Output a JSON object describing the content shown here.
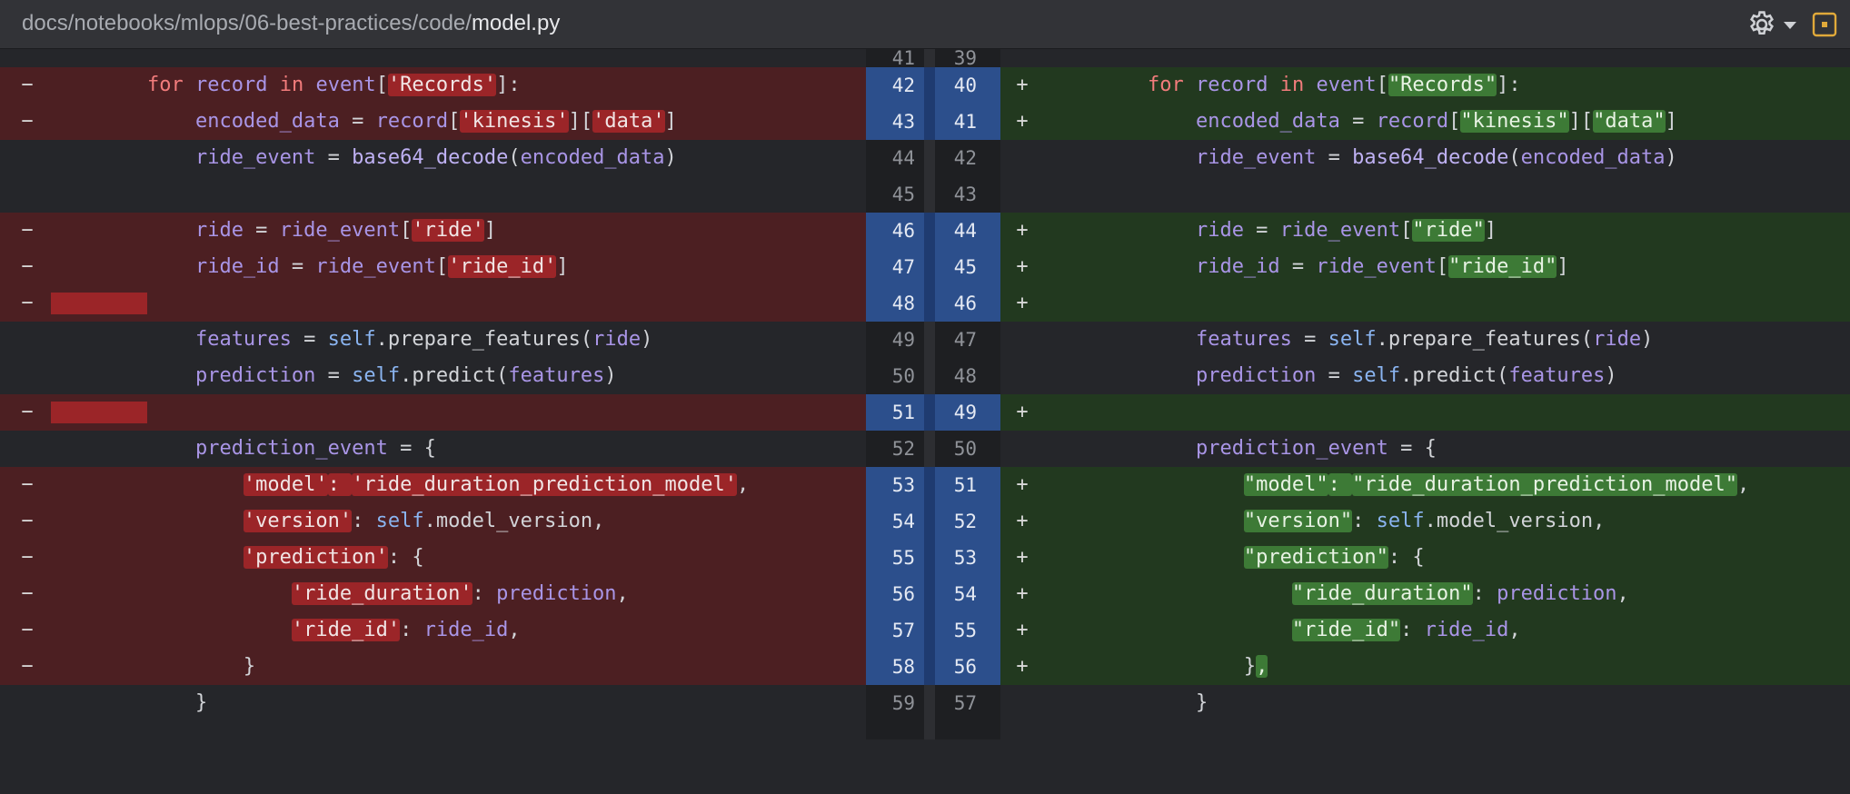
{
  "header": {
    "path_prefix": "docs/notebooks/mlops/06-best-practices/code/",
    "file_name": "model.py"
  },
  "diff": {
    "colors": {
      "deleted_bg": "#4c1f22",
      "added_bg": "#22391f",
      "line_number_changed_bg": "#2c4f8c"
    },
    "rows": [
      {
        "l": "41",
        "r": "39"
      },
      {
        "l": "42",
        "r": "40",
        "dm": "−",
        "am": "+"
      },
      {
        "l": "43",
        "r": "41",
        "dm": "−",
        "am": "+"
      },
      {
        "l": "44",
        "r": "42"
      },
      {
        "l": "45",
        "r": "43"
      },
      {
        "l": "46",
        "r": "44",
        "dm": "−",
        "am": "+"
      },
      {
        "l": "47",
        "r": "45",
        "dm": "−",
        "am": "+"
      },
      {
        "l": "48",
        "r": "46",
        "dm": "−",
        "am": "+"
      },
      {
        "l": "49",
        "r": "47"
      },
      {
        "l": "50",
        "r": "48"
      },
      {
        "l": "51",
        "r": "49",
        "dm": "−",
        "am": "+"
      },
      {
        "l": "52",
        "r": "50"
      },
      {
        "l": "53",
        "r": "51",
        "dm": "−",
        "am": "+"
      },
      {
        "l": "54",
        "r": "52",
        "dm": "−",
        "am": "+"
      },
      {
        "l": "55",
        "r": "53",
        "dm": "−",
        "am": "+"
      },
      {
        "l": "56",
        "r": "54",
        "dm": "−",
        "am": "+"
      },
      {
        "l": "57",
        "r": "55",
        "dm": "−",
        "am": "+"
      },
      {
        "l": "58",
        "r": "56",
        "dm": "−",
        "am": "+"
      },
      {
        "l": "59",
        "r": "57"
      }
    ],
    "tok": {
      "for": "for",
      "record": "record",
      "in": "in",
      "event": "event",
      "encoded_data": "encoded_data",
      "ride_event": "ride_event",
      "base64_decode": "base64_decode",
      "ride": "ride",
      "ride_id": "ride_id",
      "features": "features",
      "self": "self",
      "prepare_features": "prepare_features",
      "prediction": "prediction",
      "predict": "predict",
      "prediction_event": "prediction_event",
      "model_version": "model_version",
      "s_records": "'Records'",
      "s_kinesis": "'kinesis'",
      "s_data": "'data'",
      "s_ride": "'ride'",
      "s_ride_id": "'ride_id'",
      "s_model": "'model'",
      "s_model_name": "'ride_duration_prediction_model'",
      "s_version": "'version'",
      "s_prediction": "'prediction'",
      "s_ride_duration": "'ride_duration'",
      "d_records": "\"Records\"",
      "d_kinesis": "\"kinesis\"",
      "d_data": "\"data\"",
      "d_ride": "\"ride\"",
      "d_ride_id": "\"ride_id\"",
      "d_model": "\"model\"",
      "d_model_name": "\"ride_duration_prediction_model\"",
      "d_version": "\"version\"",
      "d_prediction": "\"prediction\"",
      "d_ride_duration": "\"ride_duration\""
    }
  }
}
